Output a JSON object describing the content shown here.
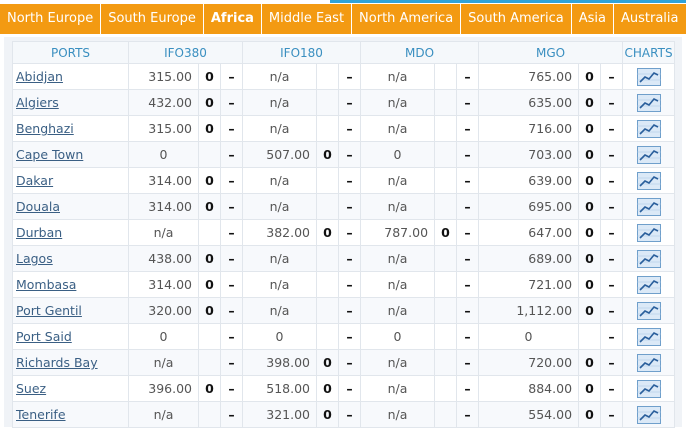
{
  "tabs": [
    {
      "label": "North Europe",
      "active": false
    },
    {
      "label": "South Europe",
      "active": false
    },
    {
      "label": "Africa",
      "active": true
    },
    {
      "label": "Middle East",
      "active": false
    },
    {
      "label": "North America",
      "active": false
    },
    {
      "label": "South America",
      "active": false
    },
    {
      "label": "Asia",
      "active": false
    },
    {
      "label": "Australia",
      "active": false
    }
  ],
  "table": {
    "headers": {
      "ports": "PORTS",
      "ifo380": "IFO380",
      "ifo180": "IFO180",
      "mdo": "MDO",
      "mgo": "MGO",
      "charts": "CHARTS"
    },
    "chart_icon": "line-chart-icon",
    "rows": [
      {
        "port": "Abidjan",
        "ifo380": {
          "price": "315.00",
          "chg": "0",
          "dir": "–"
        },
        "ifo180": {
          "price": "n/a",
          "chg": "",
          "dir": "–"
        },
        "mdo": {
          "price": "n/a",
          "chg": "",
          "dir": "–"
        },
        "mgo": {
          "price": "765.00",
          "chg": "0",
          "dir": "–"
        }
      },
      {
        "port": "Algiers",
        "ifo380": {
          "price": "432.00",
          "chg": "0",
          "dir": "–"
        },
        "ifo180": {
          "price": "n/a",
          "chg": "",
          "dir": "–"
        },
        "mdo": {
          "price": "n/a",
          "chg": "",
          "dir": "–"
        },
        "mgo": {
          "price": "635.00",
          "chg": "0",
          "dir": "–"
        }
      },
      {
        "port": "Benghazi",
        "ifo380": {
          "price": "315.00",
          "chg": "0",
          "dir": "–"
        },
        "ifo180": {
          "price": "n/a",
          "chg": "",
          "dir": "–"
        },
        "mdo": {
          "price": "n/a",
          "chg": "",
          "dir": "–"
        },
        "mgo": {
          "price": "716.00",
          "chg": "0",
          "dir": "–"
        }
      },
      {
        "port": "Cape Town",
        "ifo380": {
          "price": "0",
          "chg": "",
          "dir": "–"
        },
        "ifo180": {
          "price": "507.00",
          "chg": "0",
          "dir": "–"
        },
        "mdo": {
          "price": "0",
          "chg": "",
          "dir": "–"
        },
        "mgo": {
          "price": "703.00",
          "chg": "0",
          "dir": "–"
        }
      },
      {
        "port": "Dakar",
        "ifo380": {
          "price": "314.00",
          "chg": "0",
          "dir": "–"
        },
        "ifo180": {
          "price": "n/a",
          "chg": "",
          "dir": "–"
        },
        "mdo": {
          "price": "n/a",
          "chg": "",
          "dir": "–"
        },
        "mgo": {
          "price": "639.00",
          "chg": "0",
          "dir": "–"
        }
      },
      {
        "port": "Douala",
        "ifo380": {
          "price": "314.00",
          "chg": "0",
          "dir": "–"
        },
        "ifo180": {
          "price": "n/a",
          "chg": "",
          "dir": "–"
        },
        "mdo": {
          "price": "n/a",
          "chg": "",
          "dir": "–"
        },
        "mgo": {
          "price": "695.00",
          "chg": "0",
          "dir": "–"
        }
      },
      {
        "port": "Durban",
        "ifo380": {
          "price": "n/a",
          "chg": "",
          "dir": "–"
        },
        "ifo180": {
          "price": "382.00",
          "chg": "0",
          "dir": "–"
        },
        "mdo": {
          "price": "787.00",
          "chg": "0",
          "dir": "–"
        },
        "mgo": {
          "price": "647.00",
          "chg": "0",
          "dir": "–"
        }
      },
      {
        "port": "Lagos",
        "ifo380": {
          "price": "438.00",
          "chg": "0",
          "dir": "–"
        },
        "ifo180": {
          "price": "n/a",
          "chg": "",
          "dir": "–"
        },
        "mdo": {
          "price": "n/a",
          "chg": "",
          "dir": "–"
        },
        "mgo": {
          "price": "689.00",
          "chg": "0",
          "dir": "–"
        }
      },
      {
        "port": "Mombasa",
        "ifo380": {
          "price": "314.00",
          "chg": "0",
          "dir": "–"
        },
        "ifo180": {
          "price": "n/a",
          "chg": "",
          "dir": "–"
        },
        "mdo": {
          "price": "n/a",
          "chg": "",
          "dir": "–"
        },
        "mgo": {
          "price": "721.00",
          "chg": "0",
          "dir": "–"
        }
      },
      {
        "port": "Port Gentil",
        "ifo380": {
          "price": "320.00",
          "chg": "0",
          "dir": "–"
        },
        "ifo180": {
          "price": "n/a",
          "chg": "",
          "dir": "–"
        },
        "mdo": {
          "price": "n/a",
          "chg": "",
          "dir": "–"
        },
        "mgo": {
          "price": "1,112.00",
          "chg": "0",
          "dir": "–"
        }
      },
      {
        "port": "Port Said",
        "ifo380": {
          "price": "0",
          "chg": "",
          "dir": "–"
        },
        "ifo180": {
          "price": "0",
          "chg": "",
          "dir": "–"
        },
        "mdo": {
          "price": "0",
          "chg": "",
          "dir": "–"
        },
        "mgo": {
          "price": "0",
          "chg": "",
          "dir": "–"
        }
      },
      {
        "port": "Richards Bay",
        "ifo380": {
          "price": "n/a",
          "chg": "",
          "dir": "–"
        },
        "ifo180": {
          "price": "398.00",
          "chg": "0",
          "dir": "–"
        },
        "mdo": {
          "price": "n/a",
          "chg": "",
          "dir": "–"
        },
        "mgo": {
          "price": "720.00",
          "chg": "0",
          "dir": "–"
        }
      },
      {
        "port": "Suez",
        "ifo380": {
          "price": "396.00",
          "chg": "0",
          "dir": "–"
        },
        "ifo180": {
          "price": "518.00",
          "chg": "0",
          "dir": "–"
        },
        "mdo": {
          "price": "n/a",
          "chg": "",
          "dir": "–"
        },
        "mgo": {
          "price": "884.00",
          "chg": "0",
          "dir": "–"
        }
      },
      {
        "port": "Tenerife",
        "ifo380": {
          "price": "n/a",
          "chg": "",
          "dir": "–"
        },
        "ifo180": {
          "price": "321.00",
          "chg": "0",
          "dir": "–"
        },
        "mdo": {
          "price": "n/a",
          "chg": "",
          "dir": "–"
        },
        "mgo": {
          "price": "554.00",
          "chg": "0",
          "dir": "–"
        }
      }
    ]
  },
  "colors": {
    "tab_bar": "#f39a12",
    "header_text": "#3a8fc0",
    "link": "#3a5f84"
  }
}
